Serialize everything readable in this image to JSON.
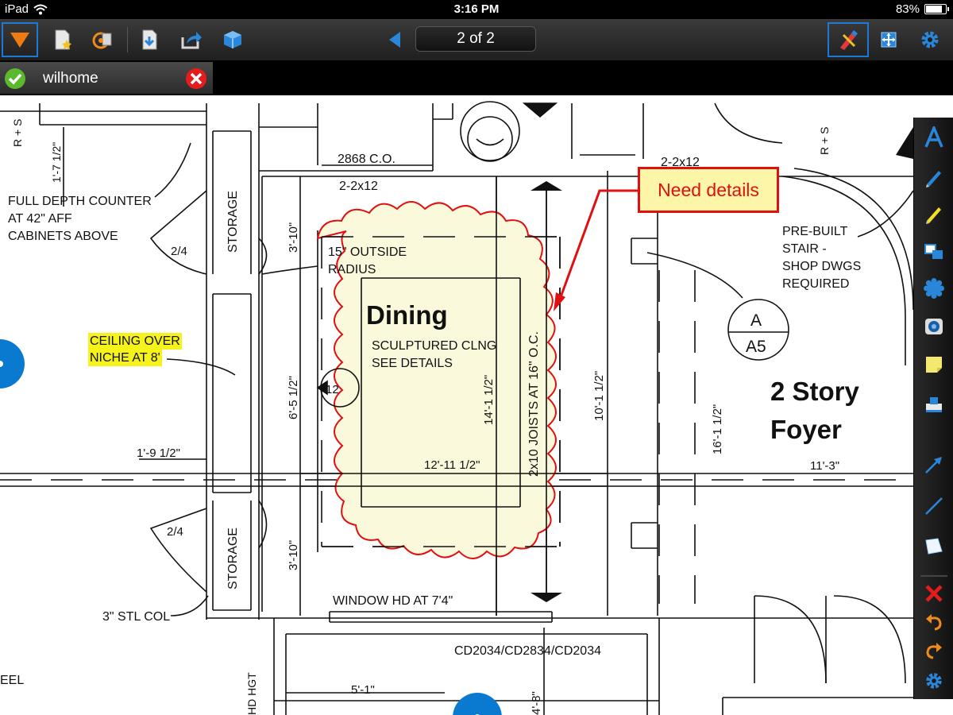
{
  "status_bar": {
    "device": "iPad",
    "time": "3:16 PM",
    "battery": "83%",
    "battery_level": 0.83
  },
  "toolbar": {
    "page_indicator": "2 of 2"
  },
  "tab": {
    "name": "wilhome"
  },
  "plan": {
    "callout": "Need details",
    "highlight_line1": "CEILING OVER",
    "highlight_line2": "NICHE AT 8'",
    "room_dining": "Dining",
    "sculptured_1": "SCULPTURED CLNG",
    "sculptured_2": "SEE DETAILS",
    "radius_1": "15\" OUTSIDE",
    "radius_2": "RADIUS",
    "foyer_1": "2 Story",
    "foyer_2": "Foyer",
    "counter_1": "FULL DEPTH COUNTER",
    "counter_2": "AT 42\" AFF",
    "counter_3": "CABINETS ABOVE",
    "stair_1": "PRE-BUILT",
    "stair_2": "STAIR -",
    "stair_3": "SHOP DWGS",
    "stair_4": "REQUIRED",
    "storage": "STORAGE",
    "door_2868": "2868 C.O.",
    "header_2x12": "2-2x12",
    "header_2x12_b": "2-2x12",
    "window_hd": "WINDOW HD AT 7'4\"",
    "col": "3\" STL COL",
    "cd_windows": "CD2034/CD2834/CD2034",
    "joists": "2x10 JOISTS AT 16\" O.C.",
    "dim_12_11": "12'-11 1/2\"",
    "dim_14_1": "14'-1 1/2\"",
    "dim_10_1": "10'-1 1/2\"",
    "dim_16_1": "16'-1 1/2\"",
    "dim_11_3": "11'-3\"",
    "dim_1_9": "1'-9 1/2\"",
    "dim_6_5": "6'-5 1/2\"",
    "dim_3_10a": "3'-10\"",
    "dim_3_10b": "3'-10\"",
    "dim_5_1": "5'-1\"",
    "dim_4_8": "4'-8\"",
    "dim_1_7": "1'-7 1/2\"",
    "door_24a": "2/4",
    "door_24b": "2/4",
    "rs_left": "R + S",
    "rs_right": "R + S",
    "detail_tag": "12",
    "section_top": "A",
    "section_bottom": "A5",
    "eel": "EEL",
    "hd_hgt": "HD HGT"
  }
}
